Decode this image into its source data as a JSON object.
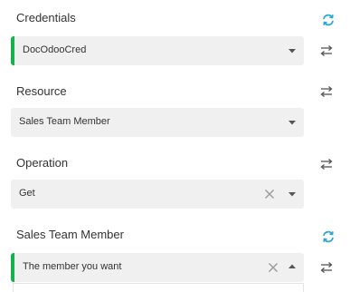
{
  "credentials": {
    "label": "Credentials",
    "value": "DocOdooCred"
  },
  "resource": {
    "label": "Resource",
    "value": "Sales Team Member"
  },
  "operation": {
    "label": "Operation",
    "value": "Get"
  },
  "sales_team_member": {
    "label": "Sales Team Member",
    "value": "The member you want"
  },
  "colors": {
    "accent": "#16b14c",
    "refresh": "#29a8d1",
    "field_bg": "#f0f0f0"
  }
}
